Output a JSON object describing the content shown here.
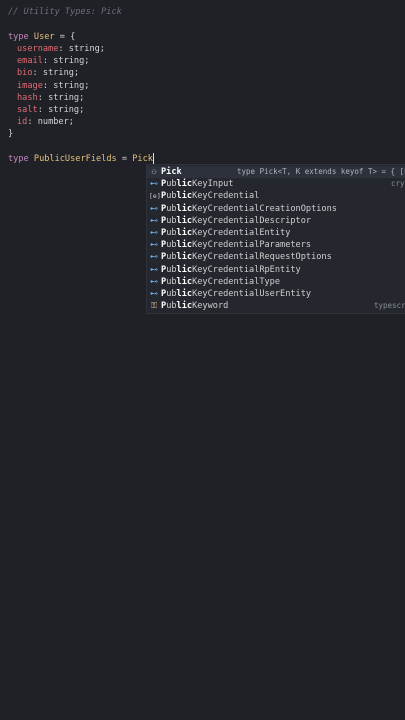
{
  "editor": {
    "comment": "// Utility Types: Pick",
    "decl1": {
      "kw": "type",
      "name": "User",
      "eq": " = {"
    },
    "fields": [
      {
        "name": "username",
        "type": "string;"
      },
      {
        "name": "email",
        "type": "string;"
      },
      {
        "name": "bio",
        "type": "string;"
      },
      {
        "name": "image",
        "type": "string;"
      },
      {
        "name": "hash",
        "type": "string;"
      },
      {
        "name": "salt",
        "type": "string;"
      },
      {
        "name": "id",
        "type": "number;"
      }
    ],
    "close": "}",
    "decl2": {
      "kw": "type",
      "name": "PublicUserFields",
      "eq": " = ",
      "typed": "Pick"
    }
  },
  "suggestions": [
    {
      "icon": "type-parameter-icon",
      "glyph": "⚇",
      "match": "Pick",
      "rest": "",
      "detail": "type Pick<T, K extends keyof T> = { [P i",
      "selected": true
    },
    {
      "icon": "interface-icon",
      "glyph": "⊷",
      "match": "P",
      "mid": "ub",
      "hl": "lic",
      "rest": "KeyInput",
      "detail": "cryp"
    },
    {
      "icon": "variable-icon",
      "glyph": "[e]",
      "match": "P",
      "mid": "ub",
      "hl": "lic",
      "rest": "KeyCredential",
      "detail": ""
    },
    {
      "icon": "interface-icon",
      "glyph": "⊷",
      "match": "P",
      "mid": "ub",
      "hl": "lic",
      "rest": "KeyCredentialCreationOptions",
      "detail": ""
    },
    {
      "icon": "interface-icon",
      "glyph": "⊷",
      "match": "P",
      "mid": "ub",
      "hl": "lic",
      "rest": "KeyCredentialDescriptor",
      "detail": ""
    },
    {
      "icon": "interface-icon",
      "glyph": "⊷",
      "match": "P",
      "mid": "ub",
      "hl": "lic",
      "rest": "KeyCredentialEntity",
      "detail": ""
    },
    {
      "icon": "interface-icon",
      "glyph": "⊷",
      "match": "P",
      "mid": "ub",
      "hl": "lic",
      "rest": "KeyCredentialParameters",
      "detail": ""
    },
    {
      "icon": "interface-icon",
      "glyph": "⊷",
      "match": "P",
      "mid": "ub",
      "hl": "lic",
      "rest": "KeyCredentialRequestOptions",
      "detail": ""
    },
    {
      "icon": "interface-icon",
      "glyph": "⊷",
      "match": "P",
      "mid": "ub",
      "hl": "lic",
      "rest": "KeyCredentialRpEntity",
      "detail": ""
    },
    {
      "icon": "interface-icon",
      "glyph": "⊷",
      "match": "P",
      "mid": "ub",
      "hl": "lic",
      "rest": "KeyCredentialType",
      "detail": ""
    },
    {
      "icon": "interface-icon",
      "glyph": "⊷",
      "match": "P",
      "mid": "ub",
      "hl": "lic",
      "rest": "KeyCredentialUserEntity",
      "detail": ""
    },
    {
      "icon": "keyword-icon",
      "glyph": "⚿",
      "match": "P",
      "mid": "ub",
      "hl": "lic",
      "rest": "Keyword",
      "detail": "typescri"
    }
  ],
  "colors": {
    "background": "#1f2127",
    "keyword": "#c586c0",
    "typeName": "#e5c07b",
    "property": "#e06c75",
    "iconBlue": "#75beff"
  }
}
